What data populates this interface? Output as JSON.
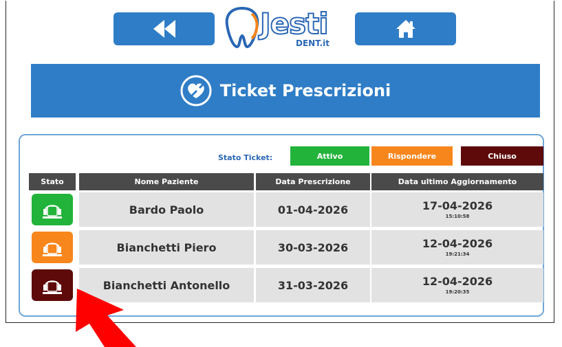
{
  "header": {
    "back_icon": "rewind-icon",
    "home_icon": "home-icon",
    "logo_text": "Jesti",
    "logo_sub": "DENT.it"
  },
  "banner": {
    "icon": "heart-wrench-icon",
    "title": "Ticket Prescrizioni"
  },
  "legend": {
    "label": "Stato Ticket:",
    "items": [
      {
        "label": "Attivo",
        "color": "#22b33a"
      },
      {
        "label": "Rispondere",
        "color": "#f7861c"
      },
      {
        "label": "Chiuso",
        "color": "#5e0a0a"
      }
    ]
  },
  "table": {
    "columns": [
      "Stato",
      "Nome Paziente",
      "Data Prescrizione",
      "Data ultimo Aggiornamento"
    ],
    "rows": [
      {
        "status": "Attivo",
        "status_color": "#22b33a",
        "name": "Bardo Paolo",
        "data_prescrizione": "01-04-2026",
        "agg_date": "17-04-2026",
        "agg_time": "15:10:58"
      },
      {
        "status": "Rispondere",
        "status_color": "#f7861c",
        "name": "Bianchetti Piero",
        "data_prescrizione": "30-03-2026",
        "agg_date": "12-04-2026",
        "agg_time": "19:21:34"
      },
      {
        "status": "Chiuso",
        "status_color": "#5e0a0a",
        "name": "Bianchetti Antonello",
        "data_prescrizione": "31-03-2026",
        "agg_date": "12-04-2026",
        "agg_time": "19:20:35"
      }
    ]
  },
  "colors": {
    "primary": "#2f7dc6",
    "header_row": "#4a4a4a",
    "cell_bg": "#e2e2e2",
    "arrow": "#ff0000"
  }
}
